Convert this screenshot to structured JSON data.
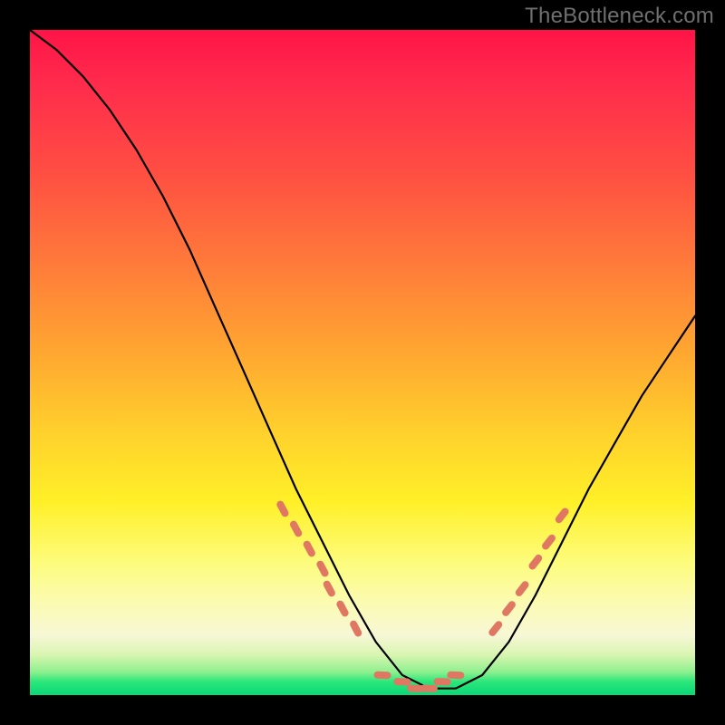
{
  "watermark": "TheBottleneck.com",
  "colors": {
    "page_bg": "#000000",
    "gradient_top": "#ff1447",
    "gradient_mid": "#ffe52b",
    "gradient_bottom": "#0ad877",
    "curve": "#000000",
    "markers": "#e07763"
  },
  "chart_data": {
    "type": "line",
    "title": "",
    "xlabel": "",
    "ylabel": "",
    "xlim": [
      0,
      100
    ],
    "ylim": [
      0,
      100
    ],
    "grid": false,
    "legend": false,
    "series": [
      {
        "name": "bottleneck-curve",
        "x": [
          0,
          4,
          8,
          12,
          16,
          20,
          24,
          28,
          32,
          36,
          40,
          44,
          48,
          52,
          56,
          60,
          64,
          68,
          72,
          76,
          80,
          84,
          88,
          92,
          96,
          100
        ],
        "y": [
          100,
          97,
          93,
          88,
          82,
          75,
          67,
          58,
          49,
          40,
          31,
          23,
          15,
          8,
          3,
          1,
          1,
          3,
          8,
          15,
          23,
          31,
          38,
          45,
          51,
          57
        ]
      }
    ],
    "markers": {
      "left_cluster": {
        "x": [
          38,
          40,
          42,
          44,
          45,
          47,
          49
        ],
        "y": [
          28,
          25,
          22,
          19,
          16,
          13,
          10
        ]
      },
      "valley_cluster": {
        "x": [
          53,
          56,
          58,
          60,
          62,
          64
        ],
        "y": [
          3,
          2,
          1,
          1,
          2,
          3
        ]
      },
      "right_cluster": {
        "x": [
          70,
          72,
          74,
          76,
          78,
          80
        ],
        "y": [
          10,
          13,
          16,
          20,
          23,
          27
        ]
      }
    }
  }
}
